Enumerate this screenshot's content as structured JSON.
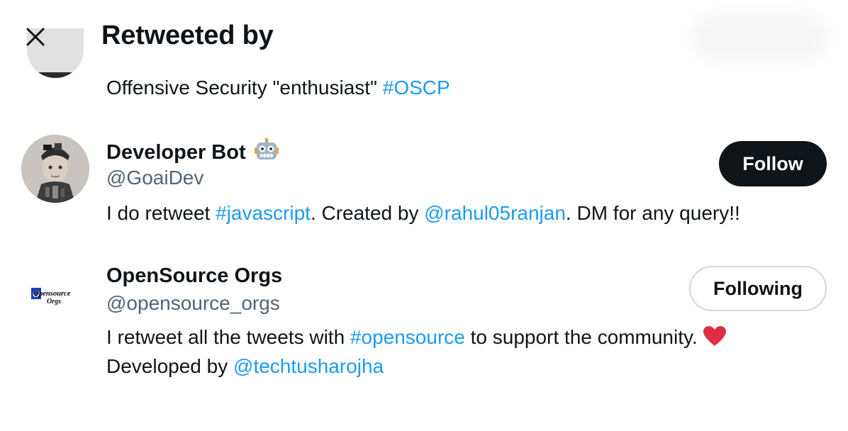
{
  "header": {
    "title": "Retweeted by",
    "close_icon": "close-icon"
  },
  "previous_user": {
    "bio_text": "Offensive Security \"enthusiast\" ",
    "bio_hashtag": "#OSCP"
  },
  "users": [
    {
      "name": "Developer Bot",
      "name_icon": "robot-emoji-icon",
      "handle": "@GoaiDev",
      "bio_part1": "I do retweet ",
      "bio_hashtag": "#javascript",
      "bio_part2": ". Created by ",
      "bio_mention": "@rahul05ranjan",
      "bio_part3": ". DM for any query!!",
      "button_label": "Follow"
    },
    {
      "name": "OpenSource Orgs",
      "handle": "@opensource_orgs",
      "avatar_text_line1": "Opensource",
      "avatar_text_line2": "Orgs",
      "bio_part1": "I retweet all the tweets with ",
      "bio_hashtag": "#opensource",
      "bio_part2": " to support the community. ",
      "bio_icon": "red-heart-emoji-icon",
      "bio_line2_text": "Developed by ",
      "bio_mention": "@techtusharojha",
      "button_label": "Following"
    }
  ],
  "colors": {
    "link": "#1d9bf0",
    "text_primary": "#0f1419",
    "text_secondary": "#536471",
    "follow_button_bg": "#0f1419",
    "following_border": "#cfd9de",
    "heart": "#e0245e"
  }
}
